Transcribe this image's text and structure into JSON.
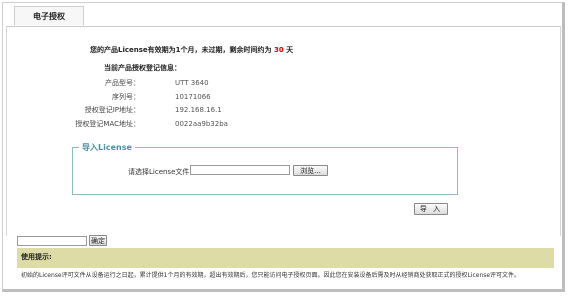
{
  "tab": {
    "title": "电子授权"
  },
  "notice": {
    "before": "您的产品License有效期为1个月，未过期，剩余时间约为 ",
    "days": "30",
    "after": " 天"
  },
  "info": {
    "title": "当前产品授权登记信息：",
    "rows": [
      {
        "label": "产品型号：",
        "value": "UTT 3640"
      },
      {
        "label": "序列号：",
        "value": "10171066"
      },
      {
        "label": "授权登记IP地址：",
        "value": "192.168.16.1"
      },
      {
        "label": "授权登记MAC地址：",
        "value": "0022aa9b32ba"
      }
    ]
  },
  "import_section": {
    "legend": "导入License",
    "file_label": "请选择License文件",
    "file_value": "",
    "browse_label": "浏览...",
    "import_label": "导 入"
  },
  "jump": {
    "input_value": "",
    "confirm_label": "确定"
  },
  "tips": {
    "title": "使用提示:",
    "text": "初始的License评可文件从设备运行之日起，累计提供1个月的有效期，超出有效期后，您只能访问电子授权页面。因此您在安装设备后需及时从经销商处获取正式的授权License评可文件。"
  },
  "colors": {
    "notice_days": "#e00000",
    "tips_bar": "#dedca6",
    "legend": "#4a8fa8"
  }
}
